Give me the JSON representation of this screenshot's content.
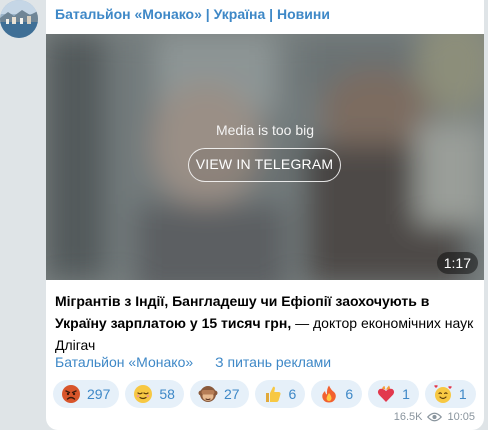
{
  "channel": {
    "title": "Батальйон «Монако» | Україна | Новини"
  },
  "media": {
    "notice": "Media is too big",
    "button_label": "VIEW IN TELEGRAM",
    "duration": "1:17"
  },
  "post": {
    "bold_text": "Мігрантів з Індії, Бангладешу чи Ефіопії заохочують в Україну зарплатою у 15 тисяч грн,",
    "plain_text": " — доктор економічних наук Длігач"
  },
  "links": {
    "channel": "Батальйон «Монако»",
    "ads": "З питань реклами"
  },
  "reactions": [
    {
      "icon": "angry-face-icon",
      "count": "297"
    },
    {
      "icon": "relieved-face-icon",
      "count": "58"
    },
    {
      "icon": "see-no-evil-monkey-icon",
      "count": "27"
    },
    {
      "icon": "thumbs-up-icon",
      "count": "6"
    },
    {
      "icon": "fire-icon",
      "count": "6"
    },
    {
      "icon": "heart-on-fire-icon",
      "count": "1"
    },
    {
      "icon": "smiling-face-with-hearts-icon",
      "count": "1"
    }
  ],
  "meta": {
    "views": "16.5K",
    "time": "10:05"
  },
  "colors": {
    "accent": "#3e88c7",
    "reaction_bg": "#e6f0f9",
    "background": "#dfe4e7"
  }
}
